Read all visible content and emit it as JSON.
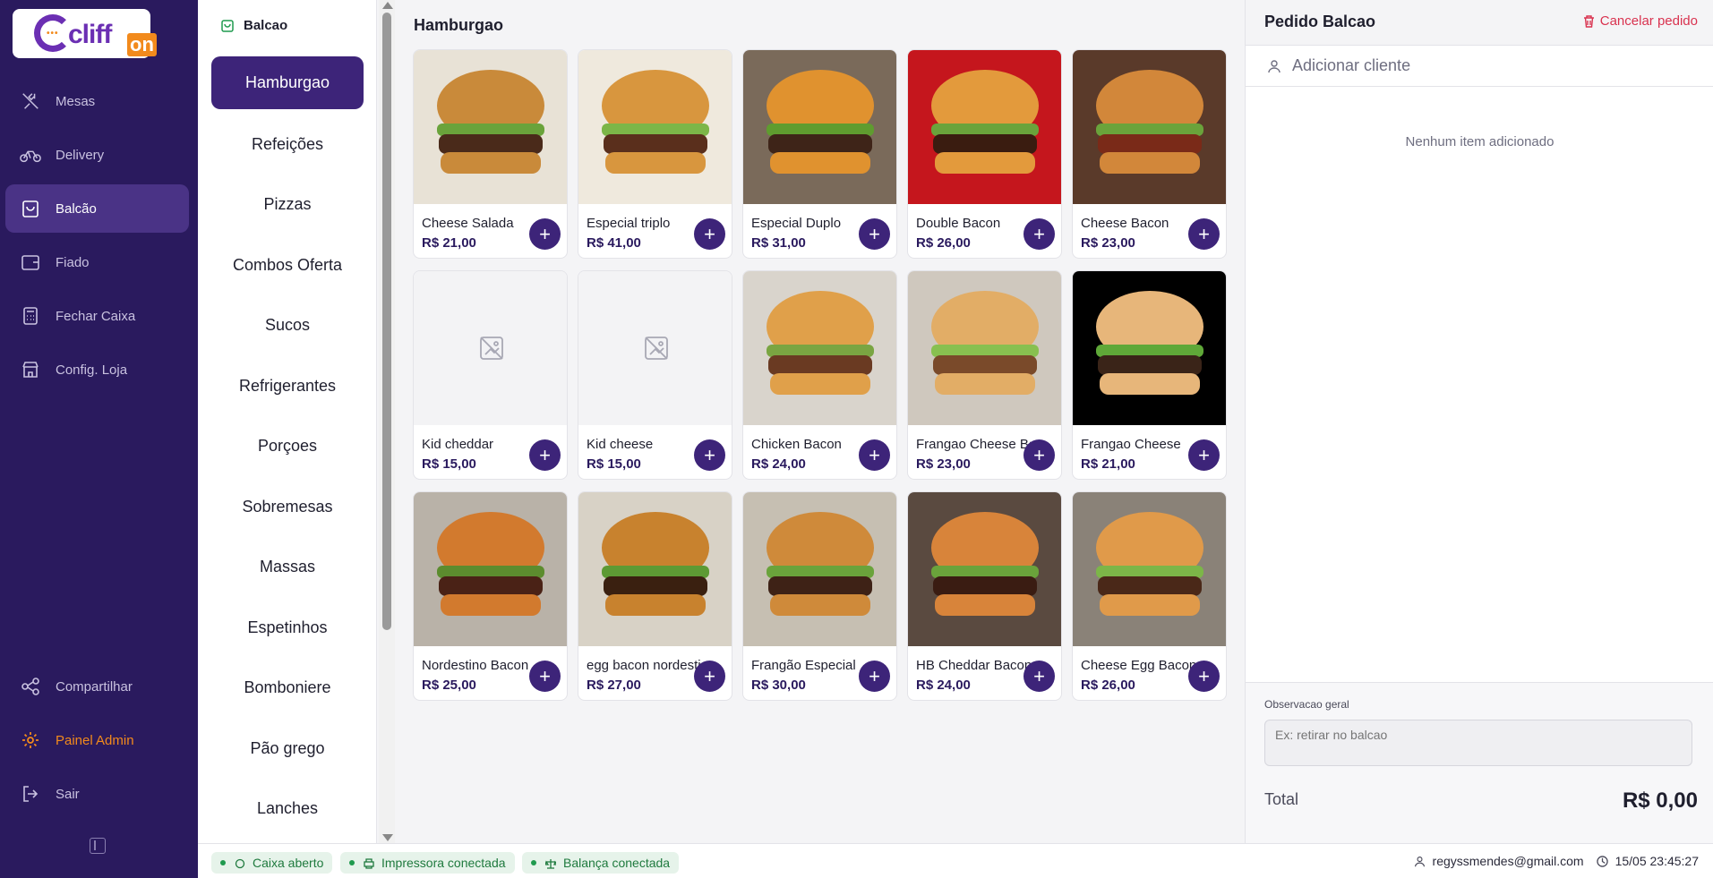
{
  "brand": {
    "logo_text": "cliff",
    "logo_suffix": "on"
  },
  "nav": {
    "items": [
      {
        "label": "Mesas",
        "icon": "utensils-icon"
      },
      {
        "label": "Delivery",
        "icon": "bike-icon"
      },
      {
        "label": "Balcão",
        "icon": "bag-icon",
        "active": true
      },
      {
        "label": "Fiado",
        "icon": "wallet-icon"
      },
      {
        "label": "Fechar Caixa",
        "icon": "calculator-icon"
      },
      {
        "label": "Config. Loja",
        "icon": "store-icon"
      }
    ],
    "bottom": [
      {
        "label": "Compartilhar",
        "icon": "share-icon"
      },
      {
        "label": "Painel Admin",
        "icon": "gear-icon"
      },
      {
        "label": "Sair",
        "icon": "logout-icon"
      }
    ]
  },
  "categories": {
    "header": "Balcao",
    "items": [
      "Hamburgao",
      "Refeições",
      "Pizzas",
      "Combos Oferta",
      "Sucos",
      "Refrigerantes",
      "Porçoes",
      "Sobremesas",
      "Massas",
      "Espetinhos",
      "Bomboniere",
      "Pão grego",
      "Lanches"
    ],
    "active": "Hamburgao"
  },
  "main": {
    "title": "Hamburgao",
    "products": [
      {
        "name": "Cheese Salada",
        "price": "R$ 21,00",
        "photo": true
      },
      {
        "name": "Especial triplo",
        "price": "R$ 41,00",
        "photo": true
      },
      {
        "name": "Especial Duplo",
        "price": "R$ 31,00",
        "photo": true
      },
      {
        "name": "Double Bacon",
        "price": "R$ 26,00",
        "photo": true
      },
      {
        "name": "Cheese Bacon",
        "price": "R$ 23,00",
        "photo": true
      },
      {
        "name": "Kid cheddar",
        "price": "R$ 15,00",
        "photo": false
      },
      {
        "name": "Kid cheese",
        "price": "R$ 15,00",
        "photo": false
      },
      {
        "name": "Chicken Bacon",
        "price": "R$ 24,00",
        "photo": true
      },
      {
        "name": "Frangao Cheese Bacon",
        "price": "R$ 23,00",
        "photo": true
      },
      {
        "name": "Frangao Cheese",
        "price": "R$ 21,00",
        "photo": true
      },
      {
        "name": "Nordestino Bacon",
        "price": "R$ 25,00",
        "photo": true
      },
      {
        "name": "egg bacon nordestino",
        "price": "R$ 27,00",
        "photo": true
      },
      {
        "name": "Frangão Especial",
        "price": "R$ 30,00",
        "photo": true
      },
      {
        "name": "HB Cheddar Bacon",
        "price": "R$ 24,00",
        "photo": true
      },
      {
        "name": "Cheese Egg Bacon",
        "price": "R$ 26,00",
        "photo": true
      }
    ],
    "add_symbol": "+"
  },
  "order": {
    "title": "Pedido Balcao",
    "cancel_label": "Cancelar pedido",
    "client_label": "Adicionar cliente",
    "empty_message": "Nenhum item adicionado",
    "obs_label": "Observacao geral",
    "obs_placeholder": "Ex: retirar no balcao",
    "total_label": "Total",
    "total_value": "R$ 0,00"
  },
  "status": {
    "pills": [
      "Caixa aberto",
      "Impressora conectada",
      "Balança conectada"
    ],
    "user_email": "regyssmendes@gmail.com",
    "datetime": "15/05 23:45:27"
  },
  "colors": {
    "nav_bg": "#2a1a5e",
    "accent": "#3d2479",
    "brand_orange": "#f28a1c",
    "danger": "#d9324f",
    "ok_green": "#1f7a3e"
  }
}
